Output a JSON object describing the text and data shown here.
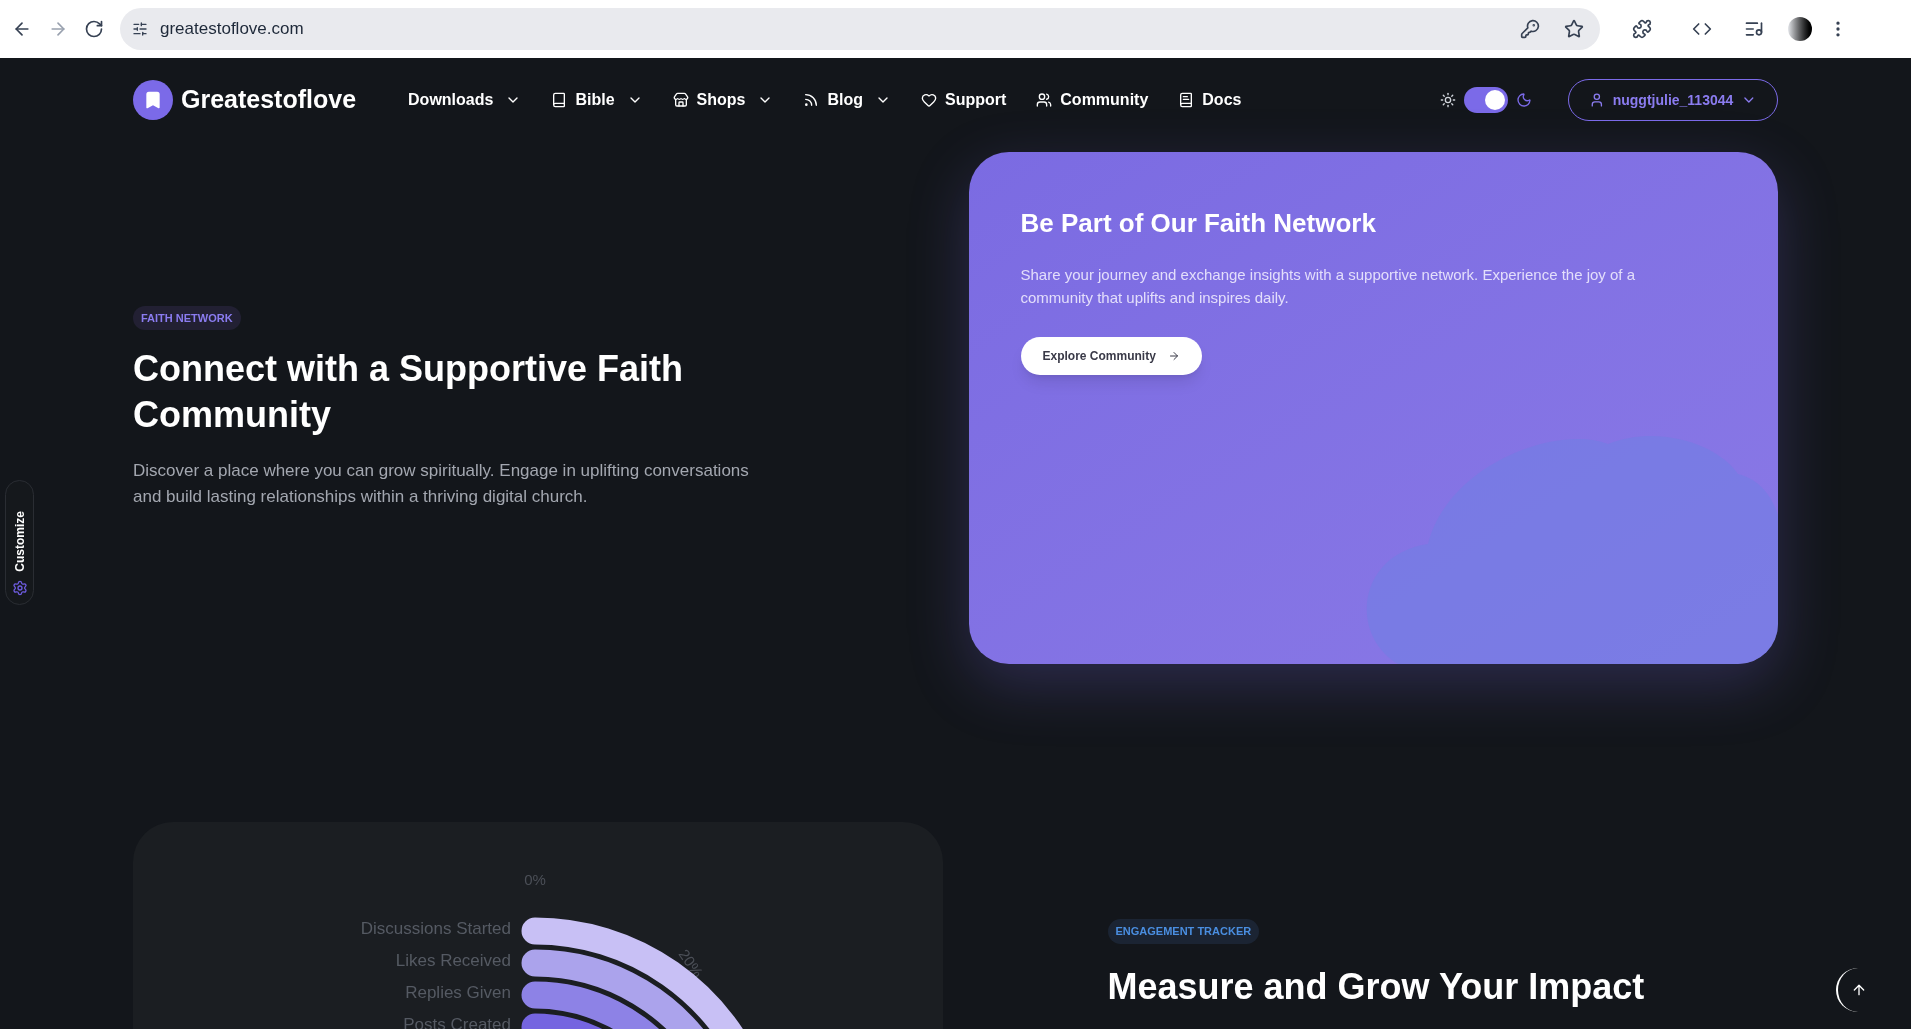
{
  "browser": {
    "url": "greatestoflove.com"
  },
  "navbar": {
    "brand": "Greatestoflove",
    "items": [
      {
        "label": "Downloads",
        "dropdown": true
      },
      {
        "label": "Bible",
        "dropdown": true
      },
      {
        "label": "Shops",
        "dropdown": true
      },
      {
        "label": "Blog",
        "dropdown": true
      },
      {
        "label": "Support",
        "dropdown": false
      },
      {
        "label": "Community",
        "dropdown": false
      },
      {
        "label": "Docs",
        "dropdown": false
      }
    ],
    "theme_toggle": {
      "on": true
    },
    "user": {
      "name": "nuggtjulie_113044"
    }
  },
  "sidebar_tab": {
    "label": "Customize"
  },
  "hero": {
    "badge": "FAITH NETWORK",
    "title": "Connect with a Supportive Faith Community",
    "text": "Discover a place where you can grow spiritually. Engage in uplifting conversations and build lasting relationships within a thriving digital church."
  },
  "cta_card": {
    "title": "Be Part of Our Faith Network",
    "text": "Share your journey and exchange insights with a supportive network. Experience the joy of a community that uplifts and inspires daily.",
    "button": "Explore Community"
  },
  "chart_card": {
    "ticks": [
      "0%",
      "20%"
    ],
    "labels": [
      "Discussions Started",
      "Likes Received",
      "Replies Given",
      "Posts Created"
    ]
  },
  "tracker": {
    "badge": "ENGAGEMENT TRACKER",
    "title": "Measure and Grow Your Impact"
  }
}
